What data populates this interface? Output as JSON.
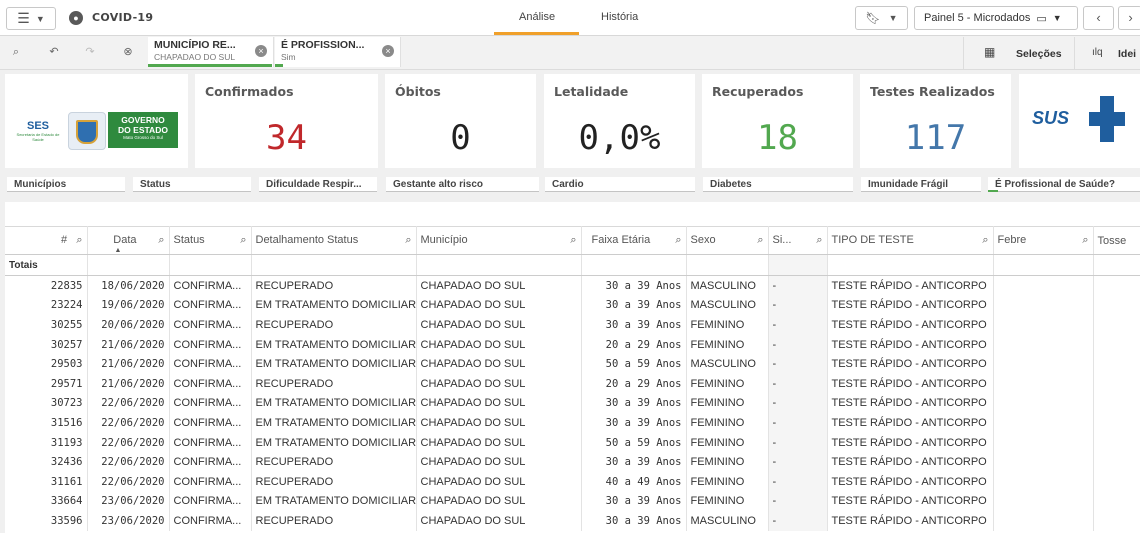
{
  "app": {
    "title": "COVID-19"
  },
  "nav": {
    "tab_analysis": "Análise",
    "tab_history": "História"
  },
  "sheet": {
    "name": "Painel 5 - Microdados"
  },
  "selections_label": "Seleções",
  "insights_label": "Idei",
  "chips": [
    {
      "title": "MUNICÍPIO RE...",
      "value": "CHAPADAO DO SUL",
      "color": "#52a84f"
    },
    {
      "title": "É PROFISSION...",
      "value": "Sim",
      "color": "#52a84f"
    }
  ],
  "logo": {
    "ses": "SES",
    "ses_sub": "Secretaria de Estado de Saúde",
    "gov_line1": "GOVERNO",
    "gov_line2": "DO ESTADO",
    "gov_line3": "Mato Grosso do Sul",
    "sus": "SUS"
  },
  "kpis": [
    {
      "label": "Confirmados",
      "value": "34",
      "color": "#c0282b"
    },
    {
      "label": "Óbitos",
      "value": "0",
      "color": "#222222"
    },
    {
      "label": "Letalidade",
      "value": "0,0%",
      "color": "#222222"
    },
    {
      "label": "Recuperados",
      "value": "18",
      "color": "#52a84f"
    },
    {
      "label": "Testes Realizados",
      "value": "117",
      "color": "#4477aa"
    }
  ],
  "filters": [
    "Municípios",
    "Status",
    "Dificuldade Respir...",
    "Gestante alto risco",
    "Cardio",
    "Diabetes",
    "Imunidade Frágil",
    "É Profissional de Saúde?"
  ],
  "table": {
    "headers": [
      "#",
      "Data",
      "Status",
      "Detalhamento Status",
      "Município",
      "Faixa Etária",
      "Sexo",
      "Si...",
      "TIPO DE TESTE",
      "Febre",
      "Tosse"
    ],
    "totals_label": "Totais",
    "rows": [
      [
        "22835",
        "18/06/2020",
        "CONFIRMA...",
        "RECUPERADO",
        "CHAPADAO DO SUL",
        "30 a 39 Anos",
        "MASCULINO",
        "-",
        "TESTE RÁPIDO - ANTICORPO"
      ],
      [
        "23224",
        "19/06/2020",
        "CONFIRMA...",
        "EM TRATAMENTO DOMICILIAR",
        "CHAPADAO DO SUL",
        "30 a 39 Anos",
        "MASCULINO",
        "-",
        "TESTE RÁPIDO - ANTICORPO"
      ],
      [
        "30255",
        "20/06/2020",
        "CONFIRMA...",
        "RECUPERADO",
        "CHAPADAO DO SUL",
        "30 a 39 Anos",
        "FEMININO",
        "-",
        "TESTE RÁPIDO - ANTICORPO"
      ],
      [
        "30257",
        "21/06/2020",
        "CONFIRMA...",
        "EM TRATAMENTO DOMICILIAR",
        "CHAPADAO DO SUL",
        "20 a 29 Anos",
        "FEMININO",
        "-",
        "TESTE RÁPIDO - ANTICORPO"
      ],
      [
        "29503",
        "21/06/2020",
        "CONFIRMA...",
        "EM TRATAMENTO DOMICILIAR",
        "CHAPADAO DO SUL",
        "50 a 59 Anos",
        "MASCULINO",
        "-",
        "TESTE RÁPIDO - ANTICORPO"
      ],
      [
        "29571",
        "21/06/2020",
        "CONFIRMA...",
        "RECUPERADO",
        "CHAPADAO DO SUL",
        "20 a 29 Anos",
        "FEMININO",
        "-",
        "TESTE RÁPIDO - ANTICORPO"
      ],
      [
        "30723",
        "22/06/2020",
        "CONFIRMA...",
        "EM TRATAMENTO DOMICILIAR",
        "CHAPADAO DO SUL",
        "30 a 39 Anos",
        "FEMININO",
        "-",
        "TESTE RÁPIDO - ANTICORPO"
      ],
      [
        "31516",
        "22/06/2020",
        "CONFIRMA...",
        "EM TRATAMENTO DOMICILIAR",
        "CHAPADAO DO SUL",
        "30 a 39 Anos",
        "FEMININO",
        "-",
        "TESTE RÁPIDO - ANTICORPO"
      ],
      [
        "31193",
        "22/06/2020",
        "CONFIRMA...",
        "EM TRATAMENTO DOMICILIAR",
        "CHAPADAO DO SUL",
        "50 a 59 Anos",
        "FEMININO",
        "-",
        "TESTE RÁPIDO - ANTICORPO"
      ],
      [
        "32436",
        "22/06/2020",
        "CONFIRMA...",
        "RECUPERADO",
        "CHAPADAO DO SUL",
        "30 a 39 Anos",
        "FEMININO",
        "-",
        "TESTE RÁPIDO - ANTICORPO"
      ],
      [
        "31161",
        "22/06/2020",
        "CONFIRMA...",
        "RECUPERADO",
        "CHAPADAO DO SUL",
        "40 a 49 Anos",
        "FEMININO",
        "-",
        "TESTE RÁPIDO - ANTICORPO"
      ],
      [
        "33664",
        "23/06/2020",
        "CONFIRMA...",
        "EM TRATAMENTO DOMICILIAR",
        "CHAPADAO DO SUL",
        "30 a 39 Anos",
        "FEMININO",
        "-",
        "TESTE RÁPIDO - ANTICORPO"
      ],
      [
        "33596",
        "23/06/2020",
        "CONFIRMA...",
        "RECUPERADO",
        "CHAPADAO DO SUL",
        "30 a 39 Anos",
        "MASCULINO",
        "-",
        "TESTE RÁPIDO - ANTICORPO"
      ]
    ]
  }
}
